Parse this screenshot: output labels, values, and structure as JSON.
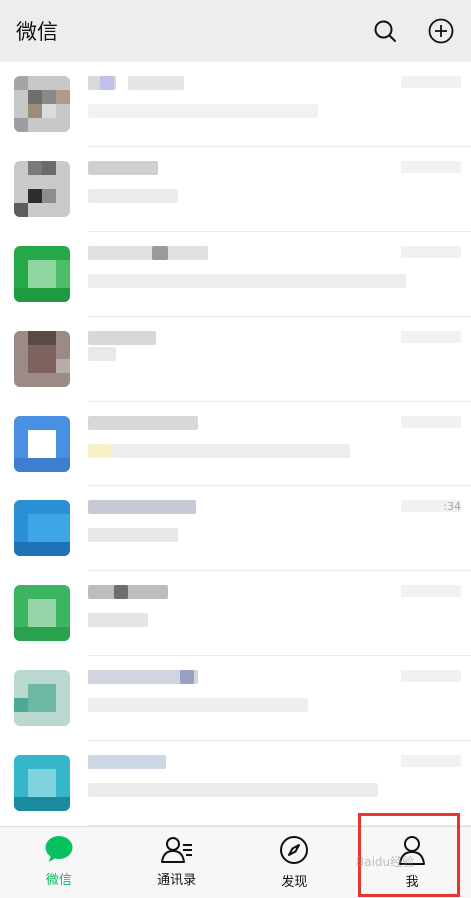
{
  "header": {
    "title": "微信",
    "search_icon": "search-icon",
    "add_icon": "plus-circle-icon"
  },
  "chat_rows": [
    {
      "time": ""
    },
    {
      "time": ""
    },
    {
      "time": ""
    },
    {
      "time": ""
    },
    {
      "time": ""
    },
    {
      "time": ":34"
    },
    {
      "time": ""
    },
    {
      "time": ""
    },
    {
      "time": ""
    }
  ],
  "tabs": [
    {
      "label": "微信",
      "icon": "chat-bubble-icon",
      "active": true,
      "color": "#07c160"
    },
    {
      "label": "通讯录",
      "icon": "contacts-icon",
      "active": false
    },
    {
      "label": "发现",
      "icon": "compass-icon",
      "active": false
    },
    {
      "label": "我",
      "icon": "person-icon",
      "active": false
    }
  ],
  "highlight_color": "#e8352d",
  "watermark": "Baidu经验"
}
